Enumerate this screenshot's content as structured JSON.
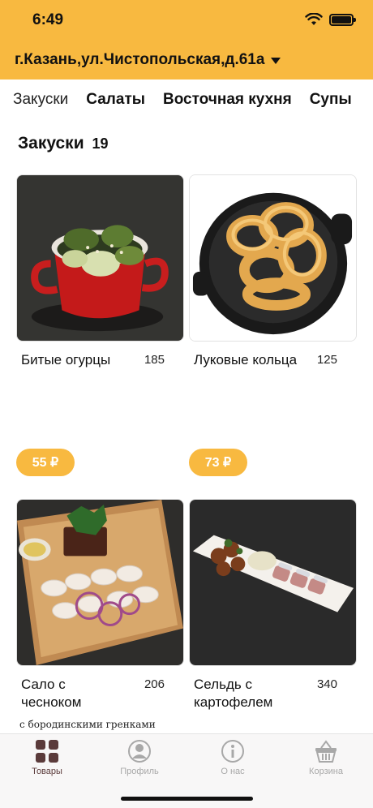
{
  "status": {
    "time": "6:49"
  },
  "header": {
    "address": "г.Казань,ул.Чистопольская,д.61а"
  },
  "tabs": [
    {
      "label": "Закуски"
    },
    {
      "label": "Салаты"
    },
    {
      "label": "Восточная кухня"
    },
    {
      "label": "Супы"
    }
  ],
  "section": {
    "title": "Закуски",
    "count": "19"
  },
  "products": [
    {
      "name": "Битые огурцы",
      "weight": "185",
      "price": "55 ₽"
    },
    {
      "name": "Луковые кольца",
      "weight": "125",
      "price": "73 ₽"
    },
    {
      "name": "Сало с чесноком",
      "weight": "206",
      "description": "с бородинскими гренками"
    },
    {
      "name": "Сельдь с картофелем",
      "weight": "340"
    }
  ],
  "nav": [
    {
      "label": "Товары",
      "icon": "grid-icon"
    },
    {
      "label": "Профиль",
      "icon": "profile-icon"
    },
    {
      "label": "О нас",
      "icon": "info-icon"
    },
    {
      "label": "Корзина",
      "icon": "basket-icon"
    }
  ],
  "colors": {
    "accent": "#f8b940",
    "nav_active": "#5b3b3b",
    "nav_inactive": "#a8a8a8"
  }
}
